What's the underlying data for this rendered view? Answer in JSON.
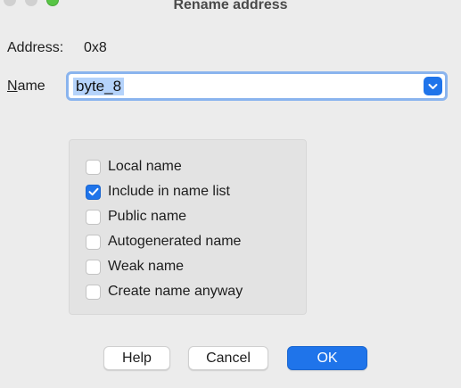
{
  "window": {
    "title": "Rename address"
  },
  "address": {
    "label": "Address:",
    "value": "0x8"
  },
  "name": {
    "label_mnemonic": "N",
    "label_rest": "ame",
    "value": "byte_8"
  },
  "options": [
    {
      "label": "Local name",
      "checked": false
    },
    {
      "label": "Include in name list",
      "checked": true
    },
    {
      "label": "Public name",
      "checked": false
    },
    {
      "label": "Autogenerated name",
      "checked": false
    },
    {
      "label": "Weak name",
      "checked": false
    },
    {
      "label": "Create name anyway",
      "checked": false
    }
  ],
  "buttons": {
    "help": "Help",
    "cancel": "Cancel",
    "ok": "OK"
  },
  "colors": {
    "accent": "#1f74ea",
    "selection": "#b5d3fb",
    "focus_ring": "#8ab4ee"
  }
}
